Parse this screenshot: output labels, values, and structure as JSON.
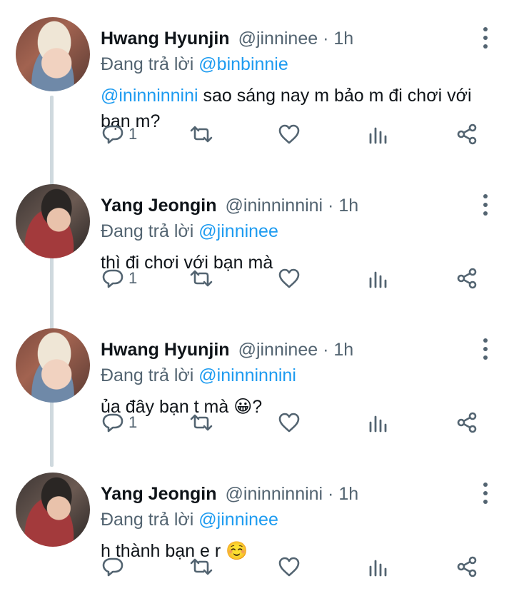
{
  "tweets": [
    {
      "author": "hyunjin",
      "name": "Hwang Hyunjin",
      "handle_time": "@jinninee · 1h",
      "reply_prefix": "Đang trả lời",
      "reply_to": "@binbinnie",
      "body_mention": "@ininninnini",
      "body_text": " sao sáng nay m bảo m đi chơi với bạn m?",
      "reply_count": "1"
    },
    {
      "author": "jeongin",
      "name": "Yang Jeongin",
      "handle_time": "@ininninnini · 1h",
      "reply_prefix": "Đang trả lời",
      "reply_to": "@jinninee",
      "body_mention": "",
      "body_text": "thì đi chơi với bạn mà",
      "reply_count": "1"
    },
    {
      "author": "hyunjin",
      "name": "Hwang Hyunjin",
      "handle_time": "@jinninee · 1h",
      "reply_prefix": "Đang trả lời",
      "reply_to": "@ininninnini",
      "body_mention": "",
      "body_text": "ủa đây bạn t mà 😀?",
      "reply_count": "1"
    },
    {
      "author": "jeongin",
      "name": "Yang Jeongin",
      "handle_time": "@ininninnini · 1h",
      "reply_prefix": "Đang trả lời",
      "reply_to": "@jinninee",
      "body_mention": "",
      "body_text": "h thành bạn e r ☺️",
      "reply_count": ""
    }
  ],
  "icons": {
    "reply": "reply-icon",
    "retweet": "retweet-icon",
    "like": "heart-icon",
    "analytics": "analytics-icon",
    "share": "share-icon",
    "more": "more-options-icon"
  },
  "colors": {
    "text": "#0f1419",
    "secondary": "#536471",
    "link": "#1d9bf0",
    "thread_line": "#cfd9de"
  }
}
